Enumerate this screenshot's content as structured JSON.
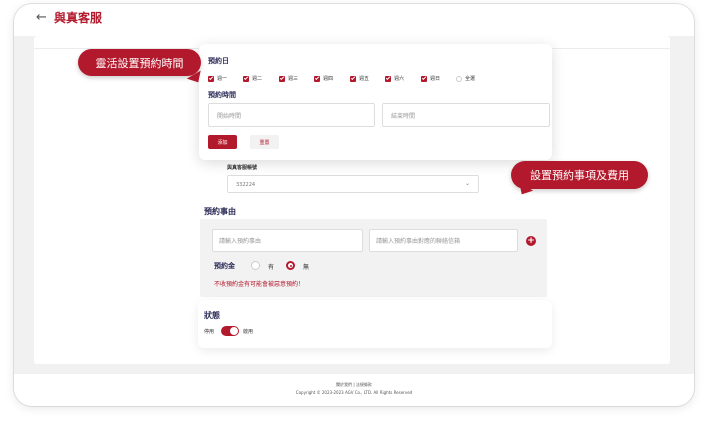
{
  "header": {
    "back_icon": "arrow-left-icon",
    "title": "與真客服"
  },
  "popup": {
    "days_title": "預約日",
    "days": [
      {
        "label": "週一",
        "checked": true
      },
      {
        "label": "週二",
        "checked": true
      },
      {
        "label": "週三",
        "checked": true
      },
      {
        "label": "週四",
        "checked": true
      },
      {
        "label": "週五",
        "checked": true
      },
      {
        "label": "週六",
        "checked": true
      },
      {
        "label": "週日",
        "checked": true
      },
      {
        "label": "全選",
        "checked": false
      }
    ],
    "time_title": "預約時間",
    "start_placeholder": "開始時間",
    "end_placeholder": "結束時間",
    "add_label": "添加",
    "reset_label": "重置"
  },
  "callouts": {
    "left": "靈活設置預約時間",
    "right": "設置預約事項及費用"
  },
  "account": {
    "label": "與真客服帳號",
    "value": "332224",
    "chevron_icon": "chevron-down-icon"
  },
  "reason": {
    "title": "預約事由",
    "reason_placeholder": "請輸入預約事由",
    "contact_placeholder": "請輸入預約事由對應的聯絡信箱",
    "add_icon": "plus-circle-icon",
    "deposit_label": "預約金",
    "deposit_yes": "有",
    "deposit_no": "無",
    "deposit_selected": "無",
    "warning": "不收預約金有可能會被惡意預約！"
  },
  "status": {
    "title": "狀態",
    "off_label": "停用",
    "on_label": "啟用",
    "enabled": true
  },
  "footer": {
    "links": "關於我們 | 法規條款",
    "copyright": "Copyright © 2023-2023 AGV Co., LTD. All Rights Reserved"
  },
  "colors": {
    "accent": "#b3192c",
    "heading": "#2d2d5a"
  }
}
